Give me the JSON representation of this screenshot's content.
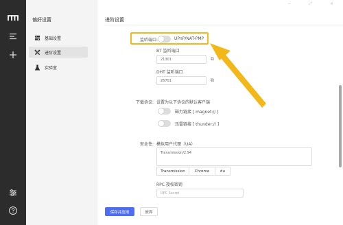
{
  "rail": {
    "logo": "app-logo",
    "icons": [
      "menu-icon",
      "plus-icon",
      "sliders-icon",
      "help-icon"
    ]
  },
  "sidebar": {
    "title": "偏好设置",
    "items": [
      {
        "label": "基础设置",
        "icon": "gear-icon",
        "active": false
      },
      {
        "label": "进阶设置",
        "icon": "tools-icon",
        "active": true
      },
      {
        "label": "实验室",
        "icon": "beaker-icon",
        "active": false
      }
    ]
  },
  "window": {
    "minimize": "−",
    "maximize": "⤢",
    "close": "×"
  },
  "main": {
    "heading": "进阶设置",
    "listen_port": {
      "label": "监听端口:",
      "toggle_label": "UPnP/NAT-PMP",
      "enabled": false
    },
    "bt_port": {
      "label": "BT 监听端口",
      "value": "21301"
    },
    "dht_port": {
      "label": "DHT 监听端口",
      "value": "26701"
    },
    "download_protocol": {
      "label": "下载协议:",
      "description": "设置为以下协议的默认客户端",
      "options": [
        {
          "label": "磁力链接 [ magnet:// ]",
          "enabled": false
        },
        {
          "label": "迅雷链接 [ thunder:// ]",
          "enabled": false
        }
      ]
    },
    "security": {
      "label": "安全性:",
      "ua_label": "模拟用户代理（UA）",
      "ua_value": "Transmission/2.94",
      "presets": [
        "Transmission",
        "Chrome",
        "du"
      ],
      "rpc_label": "RPC 授权密钥",
      "rpc_placeholder": "RPC Secret"
    },
    "save_button": "保存并应用",
    "discard_button": "放弃"
  },
  "colors": {
    "rail_bg": "#2c2c2c",
    "sidebar_bg": "#f4f4f4",
    "primary": "#4e6ef2",
    "highlight": "#f2b81a"
  }
}
